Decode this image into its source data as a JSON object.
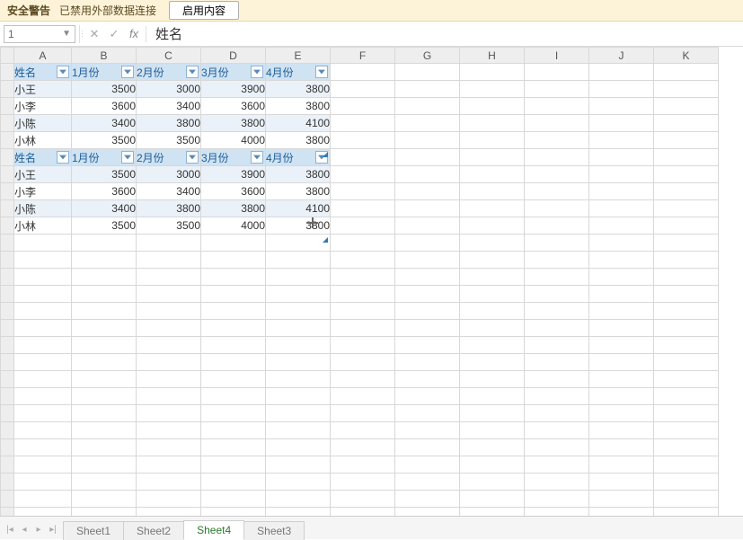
{
  "warn": {
    "title": "安全警告",
    "desc": "已禁用外部数据连接",
    "enable": "启用内容"
  },
  "namebox": "1",
  "formula": "姓名",
  "columns": [
    "A",
    "B",
    "C",
    "D",
    "E",
    "F",
    "G",
    "H",
    "I",
    "J",
    "K"
  ],
  "table1": {
    "headers": [
      "姓名",
      "1月份",
      "2月份",
      "3月份",
      "4月份"
    ],
    "rows": [
      {
        "name": "小王",
        "v": [
          3500,
          3000,
          3900,
          3800
        ]
      },
      {
        "name": "小李",
        "v": [
          3600,
          3400,
          3600,
          3800
        ]
      },
      {
        "name": "小陈",
        "v": [
          3400,
          3800,
          3800,
          4100
        ]
      },
      {
        "name": "小林",
        "v": [
          3500,
          3500,
          4000,
          3800
        ]
      }
    ]
  },
  "table2": {
    "headers": [
      "姓名",
      "1月份",
      "2月份",
      "3月份",
      "4月份"
    ],
    "rows": [
      {
        "name": "小王",
        "v": [
          3500,
          3000,
          3900,
          3800
        ]
      },
      {
        "name": "小李",
        "v": [
          3600,
          3400,
          3600,
          3800
        ]
      },
      {
        "name": "小陈",
        "v": [
          3400,
          3800,
          3800,
          4100
        ]
      },
      {
        "name": "小林",
        "v": [
          3500,
          3500,
          4000,
          3800
        ]
      }
    ]
  },
  "sheets": {
    "s1": "Sheet1",
    "s2": "Sheet2",
    "s4": "Sheet4",
    "s3": "Sheet3",
    "active": "Sheet4"
  },
  "chart_data": {
    "type": "table",
    "columns": [
      "姓名",
      "1月份",
      "2月份",
      "3月份",
      "4月份"
    ],
    "rows": [
      [
        "小王",
        3500,
        3000,
        3900,
        3800
      ],
      [
        "小李",
        3600,
        3400,
        3600,
        3800
      ],
      [
        "小陈",
        3400,
        3800,
        3800,
        4100
      ],
      [
        "小林",
        3500,
        3500,
        4000,
        3800
      ]
    ]
  }
}
